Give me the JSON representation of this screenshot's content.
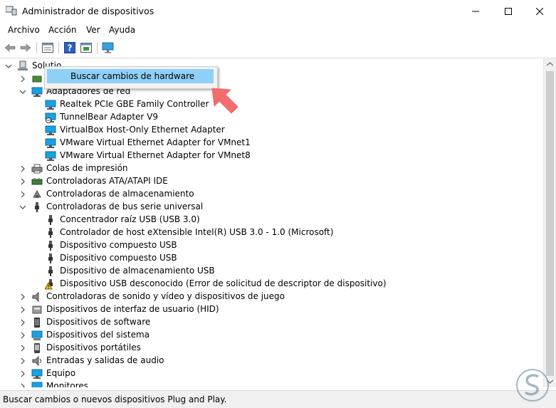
{
  "window": {
    "title": "Administrador de dispositivos"
  },
  "menubar": {
    "items": [
      "Archivo",
      "Acción",
      "Ver",
      "Ayuda"
    ]
  },
  "toolbar": {
    "icons": [
      "back-arrow-icon",
      "forward-arrow-icon",
      "properties-icon",
      "help-icon",
      "update-driver-icon",
      "monitor-scan-icon"
    ]
  },
  "tree": {
    "root": "Solutio",
    "rows": [
      {
        "label": "",
        "icon": "audio-device-icon"
      },
      {
        "label": "Adaptadores de red",
        "icon": "network-adapter-icon"
      },
      {
        "label": "Realtek PCIe GBE Family Controller",
        "icon": "network-adapter-icon"
      },
      {
        "label": "TunnelBear Adapter V9",
        "icon": "network-adapter-disabled-icon"
      },
      {
        "label": "VirtualBox Host-Only Ethernet Adapter",
        "icon": "network-adapter-icon"
      },
      {
        "label": "VMware Virtual Ethernet Adapter for VMnet1",
        "icon": "network-adapter-icon"
      },
      {
        "label": "VMware Virtual Ethernet Adapter for VMnet8",
        "icon": "network-adapter-icon"
      },
      {
        "label": "Colas de impresión",
        "icon": "printer-icon"
      },
      {
        "label": "Controladoras ATA/ATAPI IDE",
        "icon": "ide-controller-icon"
      },
      {
        "label": "Controladoras de almacenamiento",
        "icon": "storage-controller-icon"
      },
      {
        "label": "Controladoras de bus serie universal",
        "icon": "usb-icon"
      },
      {
        "label": "Concentrador raíz USB (USB 3.0)",
        "icon": "usb-icon"
      },
      {
        "label": "Controlador de host eXtensible Intel(R) USB 3.0 - 1.0 (Microsoft)",
        "icon": "usb-icon"
      },
      {
        "label": "Dispositivo compuesto USB",
        "icon": "usb-icon"
      },
      {
        "label": "Dispositivo compuesto USB",
        "icon": "usb-icon"
      },
      {
        "label": "Dispositivo de almacenamiento USB",
        "icon": "usb-icon"
      },
      {
        "label": "Dispositivo USB desconocido (Error de solicitud de descriptor de dispositivo)",
        "icon": "warning-icon"
      },
      {
        "label": "Controladoras de sonido y vídeo y dispositivos de juego",
        "icon": "speaker-icon"
      },
      {
        "label": "Dispositivos de interfaz de usuario (HID)",
        "icon": "hid-icon"
      },
      {
        "label": "Dispositivos de software",
        "icon": "software-device-icon"
      },
      {
        "label": "Dispositivos del sistema",
        "icon": "system-device-icon"
      },
      {
        "label": "Dispositivos portátiles",
        "icon": "portable-device-icon"
      },
      {
        "label": "Entradas y salidas de audio",
        "icon": "audio-io-icon"
      },
      {
        "label": "Equipo",
        "icon": "computer-icon"
      },
      {
        "label": "Monitores",
        "icon": "monitor-icon"
      }
    ]
  },
  "context_menu": {
    "item": "Buscar cambios de hardware"
  },
  "status": {
    "text": "Buscar cambios o nuevos dispositivos Plug and Play."
  },
  "colors": {
    "accent": "#8fd0f7",
    "arrow": "#f26d6d",
    "network_icon": "#1ba1e2"
  }
}
